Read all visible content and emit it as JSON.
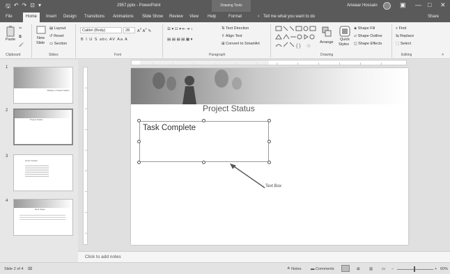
{
  "titlebar": {
    "title": "2957.pptx - PowerPoint",
    "context": "Drawing Tools",
    "user": "Anwaar Hossain",
    "ribbon_display": "▣",
    "minimize": "—",
    "maximize": "□",
    "close": "✕"
  },
  "qat": {
    "save": "🖫",
    "undo": "↶",
    "redo": "↷",
    "start": "⊡",
    "more": "▾"
  },
  "tabs": [
    "File",
    "Home",
    "Insert",
    "Design",
    "Transitions",
    "Animations",
    "Slide Show",
    "Review",
    "View",
    "Help",
    "Format"
  ],
  "tellme": "Tell me what you want to do",
  "share": "Share",
  "ribbon": {
    "clipboard": {
      "paste": "Paste",
      "label": "Clipboard"
    },
    "slides": {
      "new_slide": "New",
      "new_slide2": "Slide",
      "layout": "Layout",
      "reset": "Reset",
      "section": "Section",
      "label": "Slides"
    },
    "font": {
      "name": "Calibri (Body)",
      "size": "28",
      "label": "Font",
      "buttons": "B  I  U  S  abc  AV  Aa  A"
    },
    "paragraph": {
      "text_direction": "Text Direction",
      "align_text": "Align Text",
      "convert": "Convert to SmartArt",
      "label": "Paragraph"
    },
    "drawing": {
      "arrange": "Arrange",
      "quick_styles": "Quick",
      "quick_styles2": "Styles",
      "shape_fill": "Shape Fill",
      "shape_outline": "Shape Outline",
      "shape_effects": "Shape Effects",
      "label": "Drawing"
    },
    "editing": {
      "find": "Find",
      "replace": "Replace",
      "select": "Select",
      "label": "Editing"
    }
  },
  "thumbnails": [
    {
      "num": "1",
      "text": "Bridge to Project Status"
    },
    {
      "num": "2",
      "text": "Project Status"
    },
    {
      "num": "3",
      "text": "Issue Tracker"
    },
    {
      "num": "4",
      "text": "Next Steps"
    }
  ],
  "slide": {
    "title": "Project Status",
    "textbox": "Task Complete",
    "callout": "Text Box"
  },
  "notes": "Click to add notes",
  "status": {
    "slide_info": "Slide 2 of 4",
    "notes_btn": "Notes",
    "comments_btn": "Comments",
    "zoom": "60%"
  },
  "colors": {
    "titlebar": "#5a5a5a",
    "ribbon": "#f3f3f3",
    "canvas": "#e0e0e0"
  }
}
